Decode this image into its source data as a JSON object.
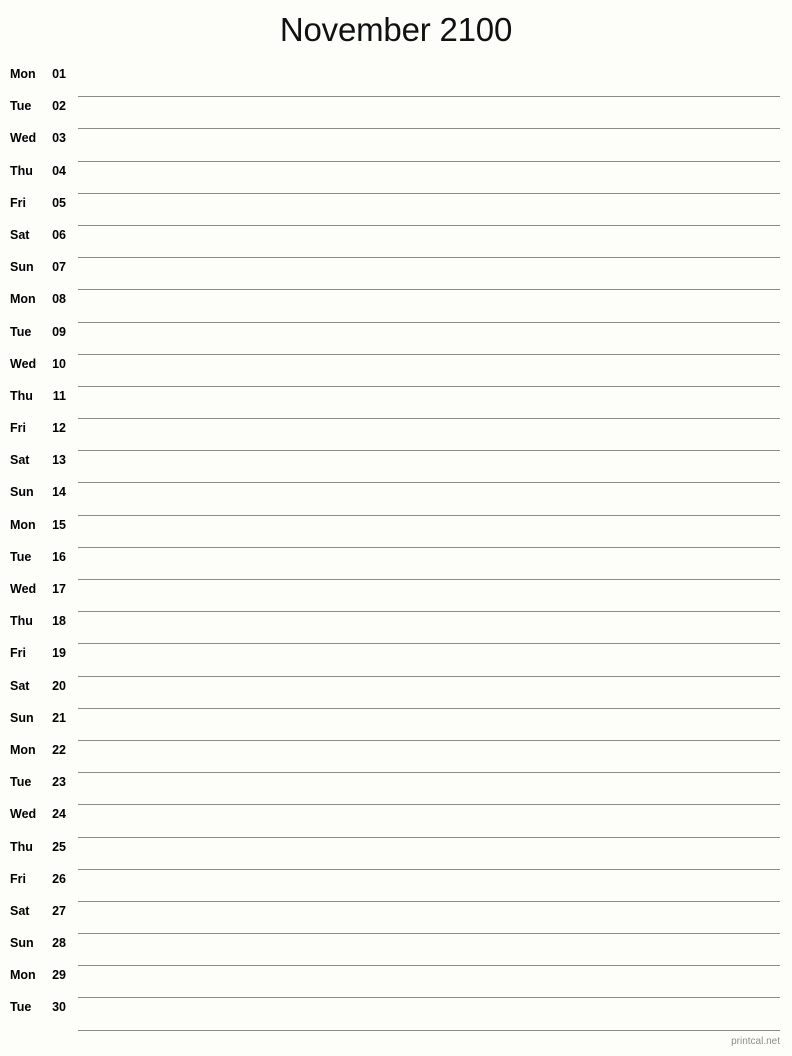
{
  "title": "November 2100",
  "month": "November",
  "year": "2100",
  "footer": {
    "credit": "printcal.net"
  },
  "colors": {
    "background": "#fdfdfa",
    "text": "#000000",
    "rule": "#8a8a8a",
    "footer_text": "#8d8d8d"
  },
  "days": [
    {
      "weekday": "Mon",
      "number": "01"
    },
    {
      "weekday": "Tue",
      "number": "02"
    },
    {
      "weekday": "Wed",
      "number": "03"
    },
    {
      "weekday": "Thu",
      "number": "04"
    },
    {
      "weekday": "Fri",
      "number": "05"
    },
    {
      "weekday": "Sat",
      "number": "06"
    },
    {
      "weekday": "Sun",
      "number": "07"
    },
    {
      "weekday": "Mon",
      "number": "08"
    },
    {
      "weekday": "Tue",
      "number": "09"
    },
    {
      "weekday": "Wed",
      "number": "10"
    },
    {
      "weekday": "Thu",
      "number": "11"
    },
    {
      "weekday": "Fri",
      "number": "12"
    },
    {
      "weekday": "Sat",
      "number": "13"
    },
    {
      "weekday": "Sun",
      "number": "14"
    },
    {
      "weekday": "Mon",
      "number": "15"
    },
    {
      "weekday": "Tue",
      "number": "16"
    },
    {
      "weekday": "Wed",
      "number": "17"
    },
    {
      "weekday": "Thu",
      "number": "18"
    },
    {
      "weekday": "Fri",
      "number": "19"
    },
    {
      "weekday": "Sat",
      "number": "20"
    },
    {
      "weekday": "Sun",
      "number": "21"
    },
    {
      "weekday": "Mon",
      "number": "22"
    },
    {
      "weekday": "Tue",
      "number": "23"
    },
    {
      "weekday": "Wed",
      "number": "24"
    },
    {
      "weekday": "Thu",
      "number": "25"
    },
    {
      "weekday": "Fri",
      "number": "26"
    },
    {
      "weekday": "Sat",
      "number": "27"
    },
    {
      "weekday": "Sun",
      "number": "28"
    },
    {
      "weekday": "Mon",
      "number": "29"
    },
    {
      "weekday": "Tue",
      "number": "30"
    }
  ]
}
